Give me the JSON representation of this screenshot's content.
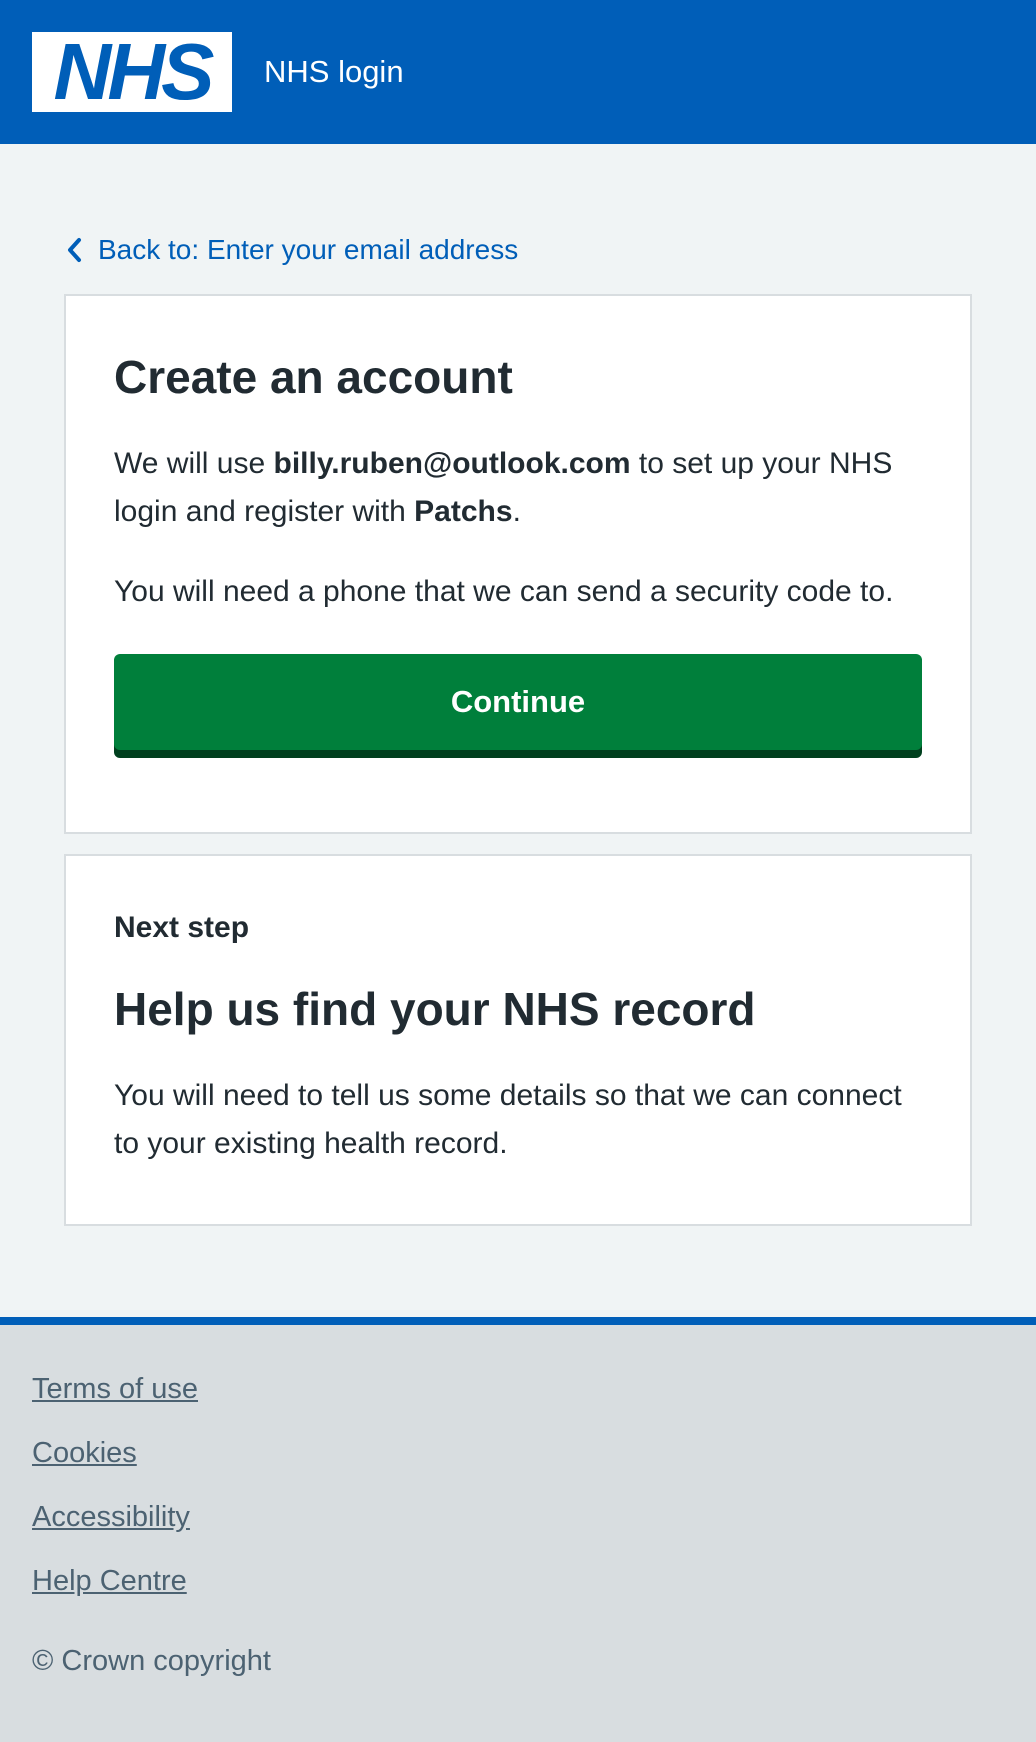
{
  "header": {
    "logo_text": "NHS",
    "service_name": "NHS login"
  },
  "back_link": {
    "label": "Back to: Enter your email address"
  },
  "create_card": {
    "title": "Create an account",
    "para1_prefix": "We will use ",
    "email": "billy.ruben@outlook.com",
    "para1_middle": " to set up your NHS login and register with ",
    "service": "Patchs",
    "para1_suffix": ".",
    "para2": "You will need a phone that we can send a security code to.",
    "continue_label": "Continue"
  },
  "next_card": {
    "caption": "Next step",
    "title": "Help us find your NHS record",
    "body": "You will need to tell us some details so that we can connect to your existing health record."
  },
  "footer": {
    "links": [
      "Terms of use",
      "Cookies",
      "Accessibility",
      "Help Centre"
    ],
    "copyright": "© Crown copyright"
  },
  "colors": {
    "nhs_blue": "#005eb8",
    "button_green": "#007f3b",
    "footer_grey": "#d8dde0",
    "page_bg": "#f0f4f5"
  },
  "icons": {
    "back": "chevron-left-icon"
  }
}
